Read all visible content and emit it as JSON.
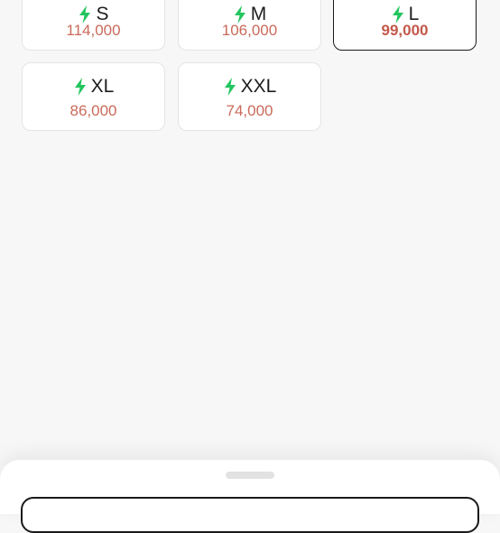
{
  "sizes": [
    {
      "label": "S",
      "price": "114,000",
      "selected": false
    },
    {
      "label": "M",
      "price": "106,000",
      "selected": false
    },
    {
      "label": "L",
      "price": "99,000",
      "selected": true
    },
    {
      "label": "XL",
      "price": "86,000",
      "selected": false
    },
    {
      "label": "XXL",
      "price": "74,000",
      "selected": false
    }
  ],
  "icons": {
    "size_icon": "lightning-bolt-icon"
  },
  "colors": {
    "accent_green": "#22c55e",
    "price_red": "#c96a5a",
    "selected_border": "#1a1a1a"
  }
}
